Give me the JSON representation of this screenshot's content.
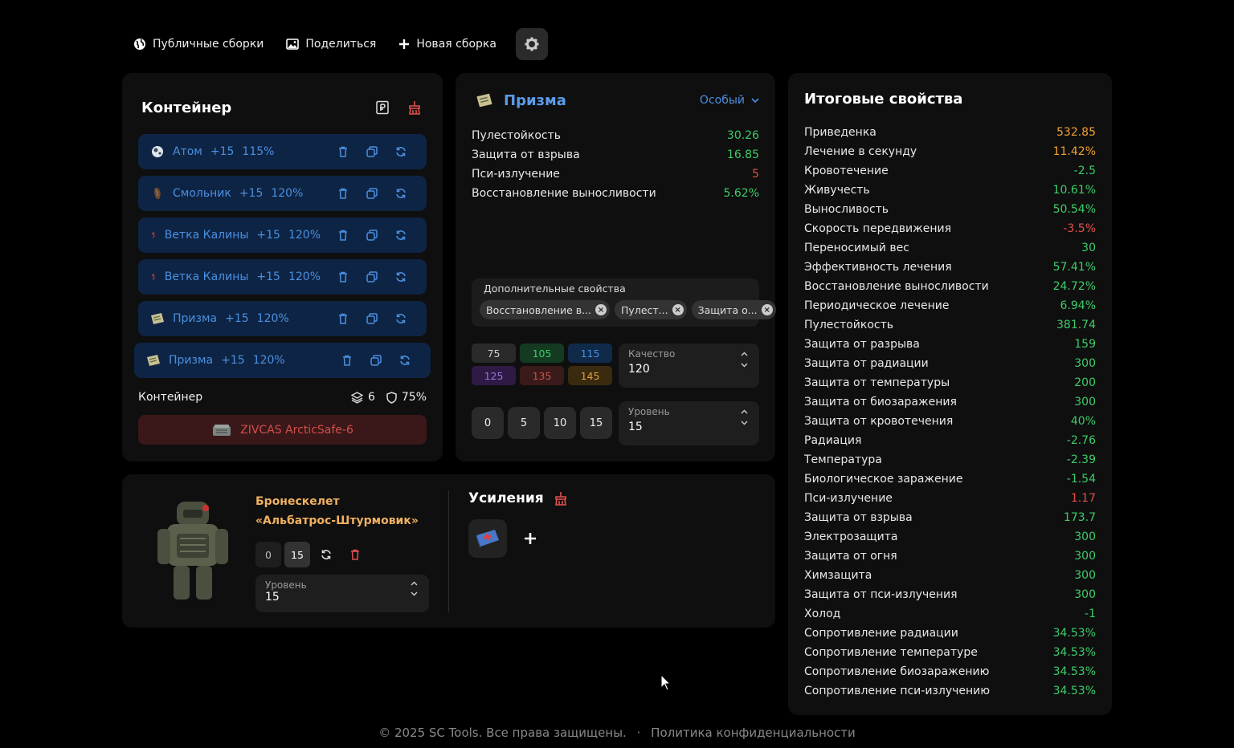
{
  "nav": {
    "public_builds": "Публичные сборки",
    "share": "Поделиться",
    "new_build": "Новая сборка"
  },
  "container": {
    "title": "Контейнер",
    "slots": [
      {
        "icon": "atom-artifact-icon",
        "name": "Атом",
        "upgrade": "+15",
        "percent": "115%"
      },
      {
        "icon": "resin-artifact-icon",
        "name": "Смольник",
        "upgrade": "+15",
        "percent": "120%"
      },
      {
        "icon": "viburnum-artifact-icon",
        "name": "Ветка Калины",
        "upgrade": "+15",
        "percent": "120%"
      },
      {
        "icon": "viburnum-artifact-icon",
        "name": "Ветка Калины",
        "upgrade": "+15",
        "percent": "120%"
      },
      {
        "icon": "prism-artifact-icon",
        "name": "Призма",
        "upgrade": "+15",
        "percent": "120%"
      },
      {
        "icon": "prism-artifact-icon",
        "name": "Призма",
        "upgrade": "+15",
        "percent": "120%"
      }
    ],
    "footer_label": "Контейнер",
    "capacity": "6",
    "protection": "75%",
    "item_name": "ZIVCAS ArcticSafe-6"
  },
  "artifact": {
    "name": "Призма",
    "rarity": "Особый",
    "stats": [
      {
        "label": "Пулестойкость",
        "value": "30.26",
        "color": "#3dcc6a"
      },
      {
        "label": "Защита от взрыва",
        "value": "16.85",
        "color": "#3dcc6a"
      },
      {
        "label": "Пси-излучение",
        "value": "5",
        "color": "#e0504a"
      },
      {
        "label": "Восстановление выносливости",
        "value": "5.62%",
        "color": "#3dcc6a"
      }
    ],
    "extra_title": "Дополнительные свойства",
    "extra_chips": [
      "Восстановление в...",
      "Пулест...",
      "Защита о..."
    ],
    "quality_presets": [
      {
        "value": "75",
        "bg": "#2a2a2a",
        "color": "#cfcfcf"
      },
      {
        "value": "105",
        "bg": "#143a22",
        "color": "#3dcc6a"
      },
      {
        "value": "115",
        "bg": "#102a4a",
        "color": "#4a8fe0"
      },
      {
        "value": "125",
        "bg": "#2e1a44",
        "color": "#a070e0"
      },
      {
        "value": "135",
        "bg": "#3a1a1a",
        "color": "#d05050"
      },
      {
        "value": "145",
        "bg": "#3a2a10",
        "color": "#e0a040"
      }
    ],
    "quality_label": "Качество",
    "quality_value": "120",
    "level_presets": [
      "0",
      "5",
      "10",
      "15"
    ],
    "level_label": "Уровень",
    "level_value": "15"
  },
  "armor": {
    "name_line1": "Бронескелет",
    "name_line2": "«Альбатрос-Штурмовик»",
    "levels": [
      "0",
      "15"
    ],
    "level_label": "Уровень",
    "level_value": "15"
  },
  "boosts": {
    "title": "Усиления",
    "slot_icon": "medkit-icon"
  },
  "totals": {
    "title": "Итоговые свойства",
    "stats": [
      {
        "label": "Приведенка",
        "value": "532.85",
        "color": "#f0a030"
      },
      {
        "label": "Лечение в секунду",
        "value": "11.42%",
        "color": "#f0a030"
      },
      {
        "label": "Кровотечение",
        "value": "-2.5",
        "color": "#3dcc6a"
      },
      {
        "label": "Живучесть",
        "value": "10.61%",
        "color": "#3dcc6a"
      },
      {
        "label": "Выносливость",
        "value": "50.54%",
        "color": "#3dcc6a"
      },
      {
        "label": "Скорость передвижения",
        "value": "-3.5%",
        "color": "#e0504a"
      },
      {
        "label": "Переносимый вес",
        "value": "30",
        "color": "#3dcc6a"
      },
      {
        "label": "Эффективность лечения",
        "value": "57.41%",
        "color": "#3dcc6a"
      },
      {
        "label": "Восстановление выносливости",
        "value": "24.72%",
        "color": "#3dcc6a"
      },
      {
        "label": "Периодическое лечение",
        "value": "6.94%",
        "color": "#3dcc6a"
      },
      {
        "label": "Пулестойкость",
        "value": "381.74",
        "color": "#3dcc6a"
      },
      {
        "label": "Защита от разрыва",
        "value": "159",
        "color": "#3dcc6a"
      },
      {
        "label": "Защита от радиации",
        "value": "300",
        "color": "#3dcc6a"
      },
      {
        "label": "Защита от температуры",
        "value": "200",
        "color": "#3dcc6a"
      },
      {
        "label": "Защита от биозаражения",
        "value": "300",
        "color": "#3dcc6a"
      },
      {
        "label": "Защита от кровотечения",
        "value": "40%",
        "color": "#3dcc6a"
      },
      {
        "label": "Радиация",
        "value": "-2.76",
        "color": "#3dcc6a"
      },
      {
        "label": "Температура",
        "value": "-2.39",
        "color": "#3dcc6a"
      },
      {
        "label": "Биологическое заражение",
        "value": "-1.54",
        "color": "#3dcc6a"
      },
      {
        "label": "Пси-излучение",
        "value": "1.17",
        "color": "#e0504a"
      },
      {
        "label": "Защита от взрыва",
        "value": "173.7",
        "color": "#3dcc6a"
      },
      {
        "label": "Электрозащита",
        "value": "300",
        "color": "#3dcc6a"
      },
      {
        "label": "Защита от огня",
        "value": "300",
        "color": "#3dcc6a"
      },
      {
        "label": "Химзащита",
        "value": "300",
        "color": "#3dcc6a"
      },
      {
        "label": "Защита от пси-излучения",
        "value": "300",
        "color": "#3dcc6a"
      },
      {
        "label": "Холод",
        "value": "-1",
        "color": "#3dcc6a"
      },
      {
        "label": "Сопротивление радиации",
        "value": "34.53%",
        "color": "#3dcc6a"
      },
      {
        "label": "Сопротивление температуре",
        "value": "34.53%",
        "color": "#3dcc6a"
      },
      {
        "label": "Сопротивление биозаражению",
        "value": "34.53%",
        "color": "#3dcc6a"
      },
      {
        "label": "Сопротивление пси-излучению",
        "value": "34.53%",
        "color": "#3dcc6a"
      }
    ]
  },
  "footer": {
    "copyright": "© 2025 SC Tools. Все права защищены.",
    "separator": "·",
    "privacy": "Политика конфиденциальности"
  }
}
